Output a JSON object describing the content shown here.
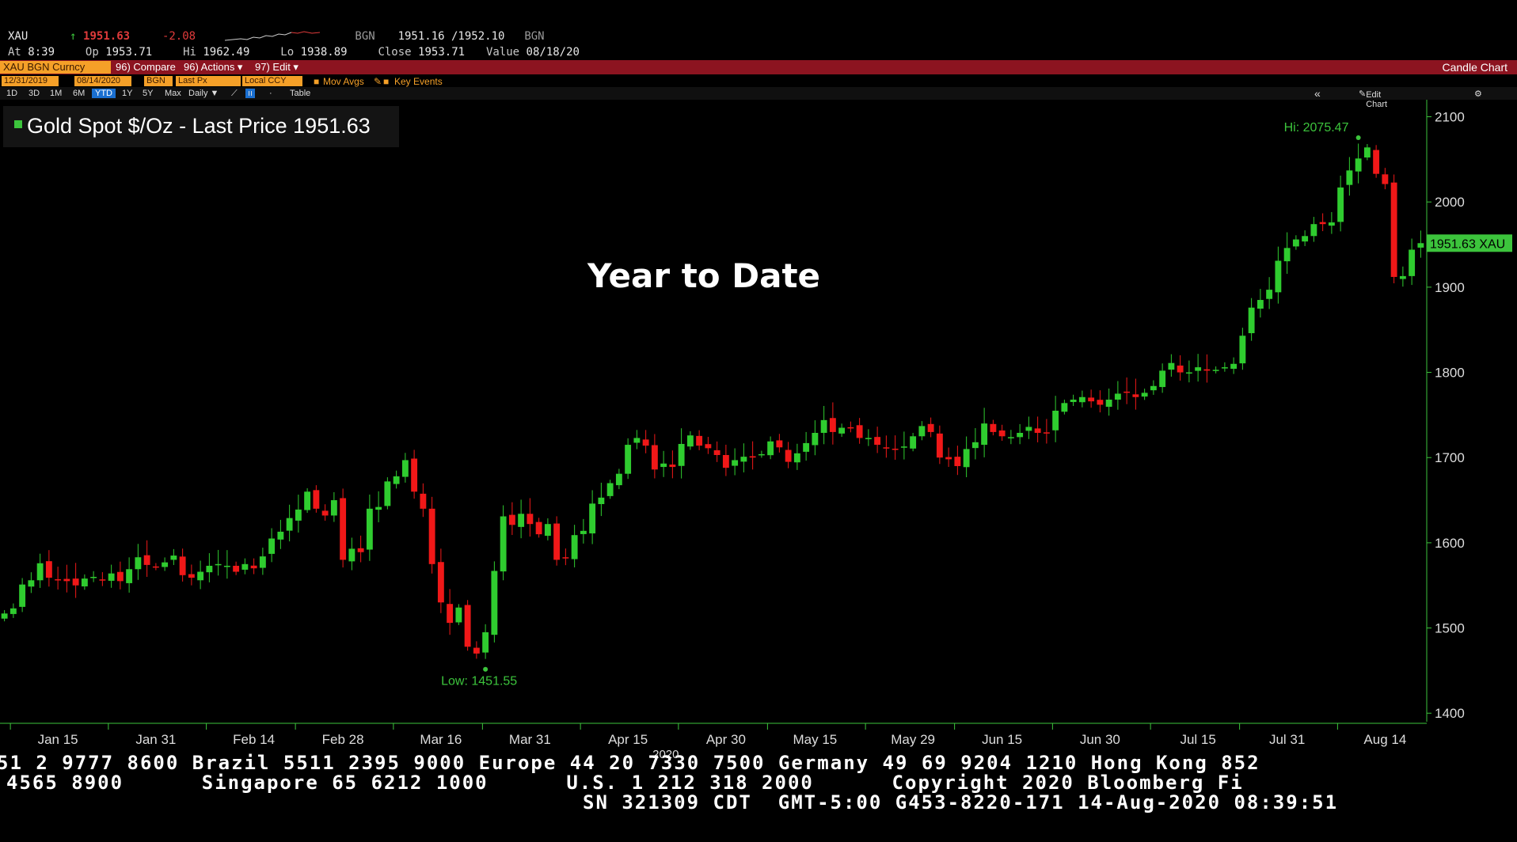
{
  "header": {
    "ticker": "XAU",
    "last_arrow": "↑",
    "last": "1951.63",
    "change": "-2.08",
    "source1": "BGN",
    "bid_ask": "1951.16 /1952.10",
    "source2": "BGN",
    "at_label": "At",
    "at_time": "8:39",
    "open_label": "Op",
    "open": "1953.71",
    "hi_label": "Hi",
    "hi": "1962.49",
    "lo_label": "Lo",
    "lo": "1938.89",
    "close_label": "Close",
    "close": "1953.71",
    "value_label": "Value",
    "value_date": "08/18/20"
  },
  "toolbar": {
    "security": "XAU BGN Curncy",
    "compare": "96) Compare",
    "actions": "96) Actions ▾",
    "edit": "97) Edit ▾",
    "title_right": "Candle Chart",
    "start_date": "12/31/2019",
    "end_date": "08/14/2020",
    "source": "BGN",
    "price_field": "Last Px",
    "currency": "Local CCY",
    "mov_avgs": "Mov Avgs",
    "key_events": "Key Events",
    "ranges": [
      "1D",
      "3D",
      "1M",
      "6M",
      "YTD",
      "1Y",
      "5Y",
      "Max"
    ],
    "period": "Daily ▼",
    "table": "Table",
    "edit_chart": "Edit Chart",
    "collapse": "«"
  },
  "legend": {
    "label": "Gold Spot $/Oz - Last Price",
    "value": "1951.63"
  },
  "overlay_text": "Year to Date",
  "chart_data": {
    "type": "candlestick",
    "title": "Gold Spot $/Oz - Last Price",
    "ylim": [
      1390,
      2120
    ],
    "yticks": [
      1400,
      1500,
      1600,
      1700,
      1800,
      1900,
      2000,
      2100
    ],
    "xticks": [
      "Jan 15",
      "Jan 31",
      "Feb 14",
      "Feb 28",
      "Mar 16",
      "Mar 31",
      "Apr 15",
      "Apr 30",
      "May 15",
      "May 29",
      "Jun 15",
      "Jun 30",
      "Jul 15",
      "Jul 31",
      "Aug 14"
    ],
    "x_year_label": "2020",
    "hi_annotation": "Hi: 2075.47",
    "low_annotation": "Low: 1451.55",
    "last_label": "1951.63 XAU",
    "closes": [
      1517,
      1523,
      1551,
      1556,
      1576,
      1559,
      1557,
      1555,
      1550,
      1558,
      1560,
      1556,
      1564,
      1555,
      1569,
      1583,
      1574,
      1571,
      1577,
      1585,
      1562,
      1559,
      1566,
      1573,
      1575,
      1573,
      1566,
      1575,
      1570,
      1584,
      1605,
      1613,
      1629,
      1639,
      1660,
      1640,
      1632,
      1650,
      1580,
      1593,
      1589,
      1640,
      1642,
      1672,
      1678,
      1697,
      1660,
      1640,
      1575,
      1530,
      1506,
      1524,
      1478,
      1470,
      1495,
      1567,
      1631,
      1621,
      1634,
      1622,
      1610,
      1622,
      1580,
      1582,
      1609,
      1614,
      1646,
      1653,
      1670,
      1681,
      1715,
      1723,
      1714,
      1686,
      1693,
      1689,
      1716,
      1726,
      1714,
      1711,
      1703,
      1688,
      1697,
      1701,
      1700,
      1704,
      1719,
      1712,
      1695,
      1705,
      1717,
      1729,
      1744,
      1730,
      1735,
      1735,
      1723,
      1723,
      1715,
      1711,
      1710,
      1713,
      1725,
      1737,
      1730,
      1700,
      1698,
      1690,
      1710,
      1718,
      1740,
      1730,
      1725,
      1724,
      1729,
      1736,
      1729,
      1729,
      1755,
      1764,
      1768,
      1771,
      1766,
      1762,
      1768,
      1775,
      1776,
      1771,
      1776,
      1784,
      1802,
      1811,
      1800,
      1800,
      1806,
      1802,
      1803,
      1806,
      1810,
      1843,
      1876,
      1885,
      1897,
      1931,
      1946,
      1956,
      1960,
      1974,
      1974,
      1976,
      2017,
      2037,
      2051,
      2064,
      2033,
      2021,
      1912,
      1913,
      1944,
      1951.63
    ]
  }
}
